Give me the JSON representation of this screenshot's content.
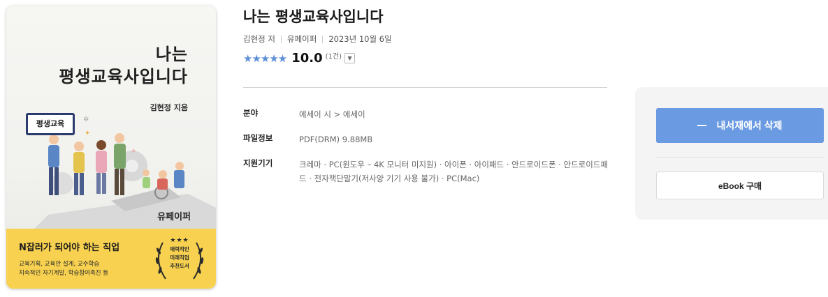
{
  "cover": {
    "title_line1": "나는",
    "title_line2": "평생교육사입니다",
    "author": "김현정 지음",
    "sign_text": "평생교육",
    "publisher": "유페이퍼",
    "band_headline": "N잡러가 되어야 하는 직업",
    "band_line1": "교육기획,  교육안 설계, 교수학습",
    "band_line2": "지속적인 자기계발, 학습참여촉진 등",
    "badge_stars": "★★★",
    "badge_line1": "매력적인",
    "badge_line2": "미래직업",
    "badge_line3": "추천도서",
    "band_color": "#f7d14f"
  },
  "book": {
    "title": "나는 평생교육사입니다",
    "author": "김현정 저",
    "publisher": "유페이퍼",
    "date": "2023년 10월 6일"
  },
  "rating": {
    "stars": "★★★★★",
    "score": "10.0",
    "count": "(1건)",
    "star_color": "#5b8fd8"
  },
  "info": {
    "genre_label": "분야",
    "genre_value": "에세이 시 > 에세이",
    "file_label": "파일정보",
    "file_value": "PDF(DRM) 9.88MB",
    "devices_label": "지원기기",
    "devices_value": "크레마 · PC(윈도우 – 4K 모니터 미지원) · 아이폰 · 아이패드 · 안드로이드폰 · 안드로이드패드 · 전자책단말기(저사양 기기 사용 불가) · PC(Mac)"
  },
  "panel": {
    "delete_label": "내서재에서 삭제",
    "buy_label": "eBook 구매",
    "accent_color": "#6a9ae2"
  }
}
